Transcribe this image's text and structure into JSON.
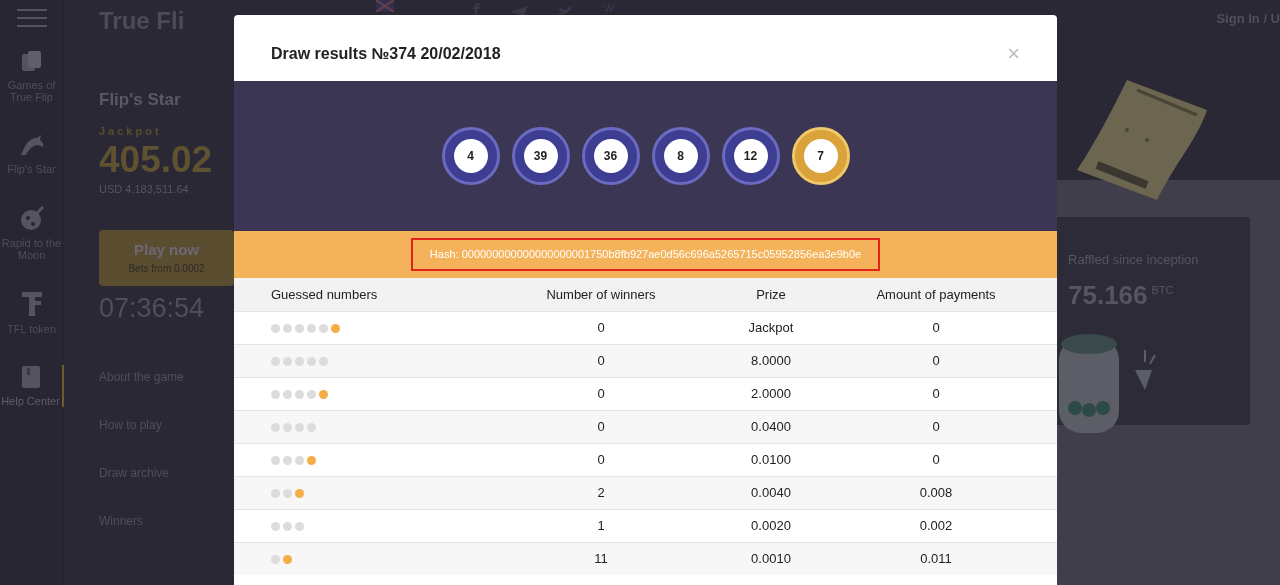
{
  "header": {
    "logo": "True Fli",
    "sign_in": "Sign In / U"
  },
  "sidebar": {
    "items": [
      {
        "label": "Games of True Flip",
        "selected": false
      },
      {
        "label": "Flip's Star",
        "selected": false
      },
      {
        "label": "Rapid to the Moon",
        "selected": false
      },
      {
        "label": "TFL token",
        "selected": false
      },
      {
        "label": "Help Center",
        "selected": true
      }
    ]
  },
  "game": {
    "title": "Flip's Star",
    "jackpot_label": "Jackpot",
    "jackpot": "405.02",
    "usd": "USD 4,183,511.64",
    "play": "Play now",
    "bets": "Bets from 0.0002",
    "timer": "07:36:54",
    "menu": [
      "About the game",
      "How to play",
      "Draw archive",
      "Winners"
    ]
  },
  "raffled": {
    "label": "Raffled since inception",
    "value": "75.166",
    "unit": "BTC"
  },
  "modal": {
    "title": "Draw results №374 20/02/2018",
    "close": "×",
    "balls": [
      {
        "number": "4",
        "kind": "main"
      },
      {
        "number": "39",
        "kind": "main"
      },
      {
        "number": "36",
        "kind": "main"
      },
      {
        "number": "8",
        "kind": "main"
      },
      {
        "number": "12",
        "kind": "main"
      },
      {
        "number": "7",
        "kind": "bonus"
      }
    ],
    "hash": "Hash: 000000000000000000001750b8fb927ae0d56c696a5265715c05952856ea3e9b0e",
    "table": {
      "columns": [
        "Guessed numbers",
        "Number of winners",
        "Prize",
        "Amount of payments"
      ],
      "rows": [
        {
          "guessed": [
            {
              "kind": "main"
            },
            {
              "kind": "main"
            },
            {
              "kind": "main"
            },
            {
              "kind": "main"
            },
            {
              "kind": "main"
            },
            {
              "kind": "bonus"
            }
          ],
          "winners": "0",
          "prize": "Jackpot",
          "amount": "0"
        },
        {
          "guessed": [
            {
              "kind": "main"
            },
            {
              "kind": "main"
            },
            {
              "kind": "main"
            },
            {
              "kind": "main"
            },
            {
              "kind": "main"
            }
          ],
          "winners": "0",
          "prize": "8.0000",
          "amount": "0"
        },
        {
          "guessed": [
            {
              "kind": "main"
            },
            {
              "kind": "main"
            },
            {
              "kind": "main"
            },
            {
              "kind": "main"
            },
            {
              "kind": "bonus"
            }
          ],
          "winners": "0",
          "prize": "2.0000",
          "amount": "0"
        },
        {
          "guessed": [
            {
              "kind": "main"
            },
            {
              "kind": "main"
            },
            {
              "kind": "main"
            },
            {
              "kind": "main"
            }
          ],
          "winners": "0",
          "prize": "0.0400",
          "amount": "0"
        },
        {
          "guessed": [
            {
              "kind": "main"
            },
            {
              "kind": "main"
            },
            {
              "kind": "main"
            },
            {
              "kind": "bonus"
            }
          ],
          "winners": "0",
          "prize": "0.0100",
          "amount": "0"
        },
        {
          "guessed": [
            {
              "kind": "main"
            },
            {
              "kind": "main"
            },
            {
              "kind": "bonus"
            }
          ],
          "winners": "2",
          "prize": "0.0040",
          "amount": "0.008"
        },
        {
          "guessed": [
            {
              "kind": "main"
            },
            {
              "kind": "main"
            },
            {
              "kind": "main"
            }
          ],
          "winners": "1",
          "prize": "0.0020",
          "amount": "0.002"
        },
        {
          "guessed": [
            {
              "kind": "main"
            },
            {
              "kind": "bonus"
            }
          ],
          "winners": "11",
          "prize": "0.0010",
          "amount": "0.011"
        }
      ]
    }
  }
}
